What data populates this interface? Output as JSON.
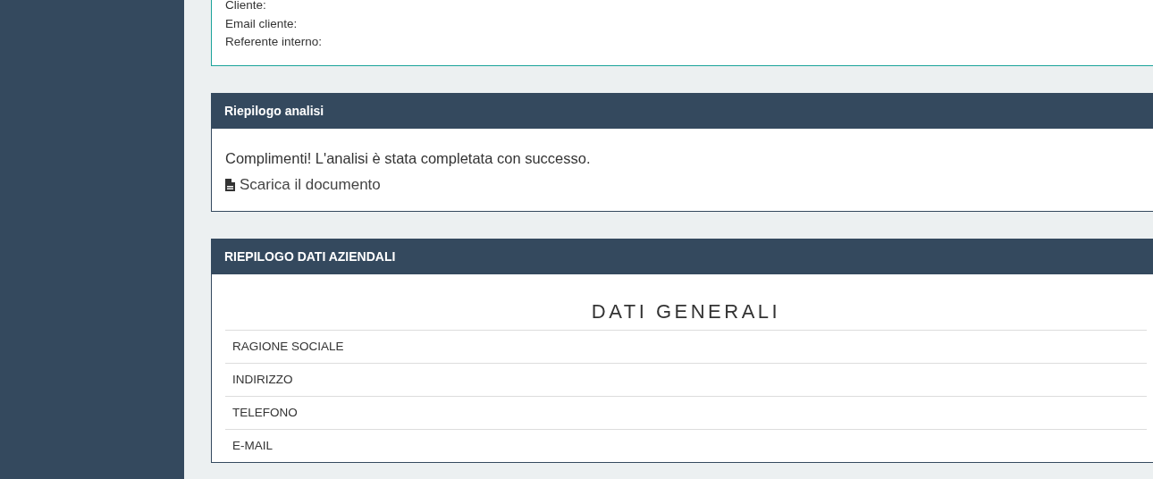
{
  "client_info": {
    "fields": [
      "Cliente:",
      "Email cliente:",
      "Referente interno:"
    ]
  },
  "analysis_summary": {
    "title": "Riepilogo analisi",
    "message": "Complimenti! L'analisi è stata completata con successo.",
    "download_link": "Scarica il documento"
  },
  "company_summary": {
    "title": "RIEPILOGO DATI AZIENDALI",
    "section_title": "DATI GENERALI",
    "rows": [
      "RAGIONE SOCIALE",
      "INDIRIZZO",
      "TELEFONO",
      "E-MAIL"
    ]
  }
}
